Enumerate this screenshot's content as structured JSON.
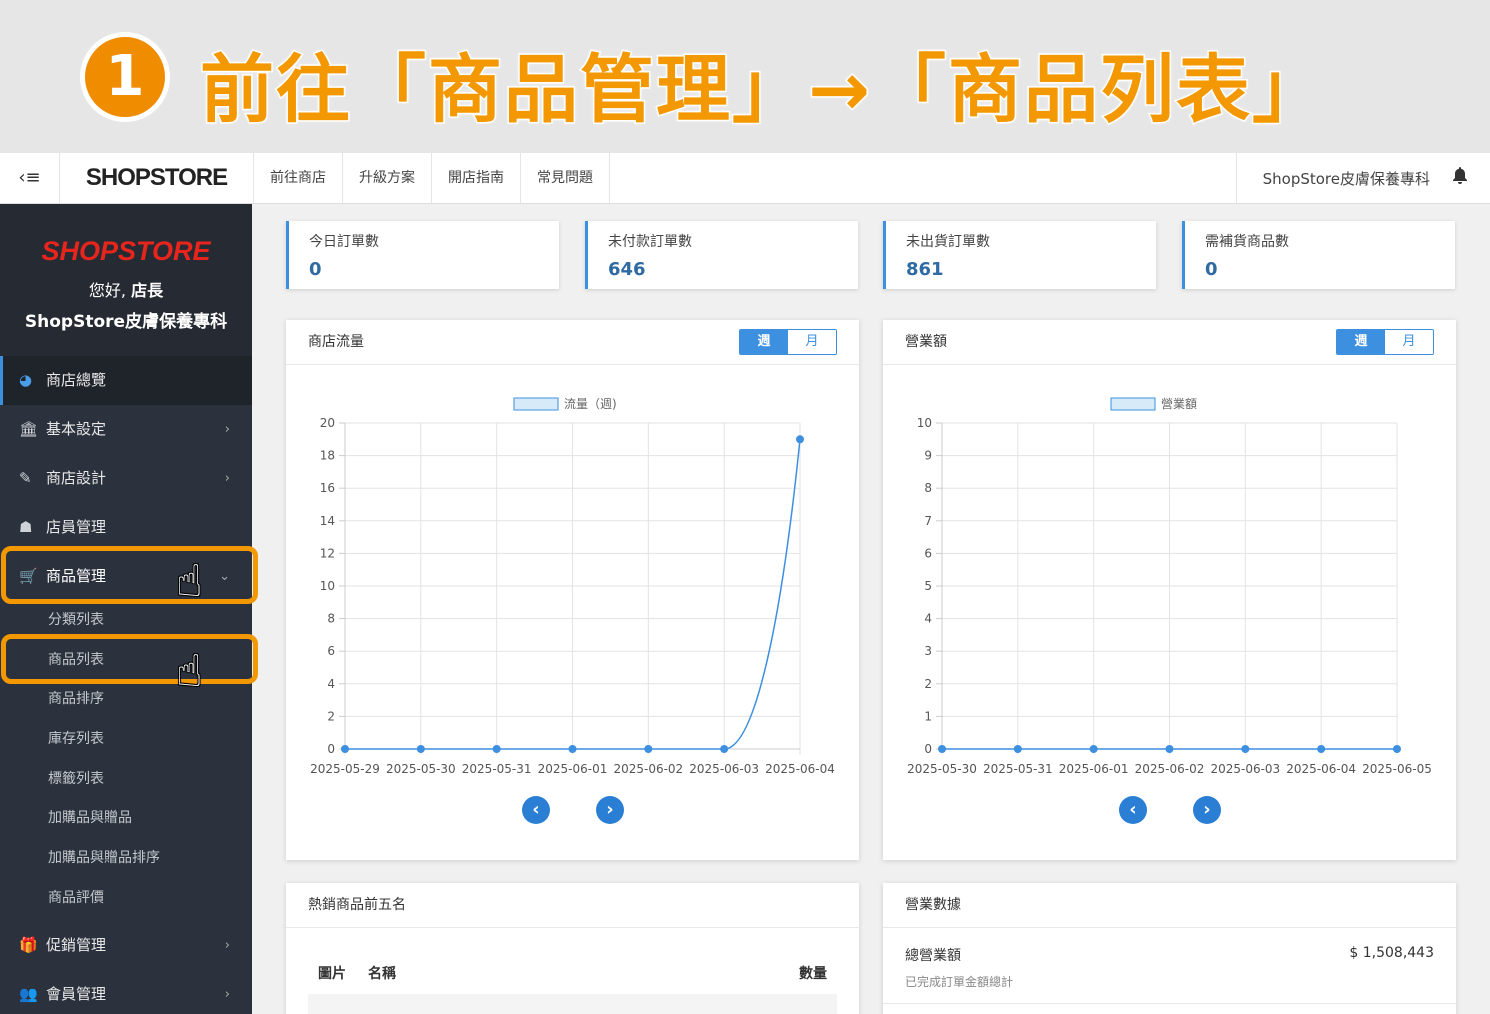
{
  "banner": {
    "step_number": "1",
    "text": "前往「商品管理」→「商品列表」"
  },
  "topbar": {
    "toggle_label": "‹≡",
    "logo": "SHOPSTORE",
    "nav": [
      "前往商店",
      "升級方案",
      "開店指南",
      "常見問題"
    ],
    "store_name": "ShopStore皮膚保養專科"
  },
  "sidebar": {
    "logo": "SHOPSTORE",
    "hello": "您好,",
    "hello_role": "店長",
    "store": "ShopStore皮膚保養專科",
    "items": [
      {
        "label": "商店總覽"
      },
      {
        "label": "基本設定"
      },
      {
        "label": "商店設計"
      },
      {
        "label": "店員管理"
      },
      {
        "label": "商品管理"
      }
    ],
    "subitems": [
      "分類列表",
      "商品列表",
      "商品排序",
      "庫存列表",
      "標籤列表",
      "加購品與贈品",
      "加購品與贈品排序",
      "商品評價"
    ],
    "after_items": [
      {
        "label": "促銷管理"
      },
      {
        "label": "會員管理"
      }
    ]
  },
  "stats": [
    {
      "label": "今日訂單數",
      "value": "0"
    },
    {
      "label": "未付款訂單數",
      "value": "646"
    },
    {
      "label": "未出貨訂單數",
      "value": "861"
    },
    {
      "label": "需補貨商品數",
      "value": "0"
    }
  ],
  "traffic_panel": {
    "title": "商店流量",
    "week": "週",
    "month": "月"
  },
  "revenue_panel": {
    "title": "營業額",
    "week": "週",
    "month": "月"
  },
  "top5_panel": {
    "title": "熱銷商品前五名",
    "col_image": "圖片",
    "col_name": "名稱",
    "col_qty": "數量"
  },
  "sales_panel": {
    "title": "營業數據",
    "total_label": "總營業額",
    "total_sub": "已完成訂單金額總計",
    "total_value": "$ 1,508,443"
  },
  "colors": {
    "accent": "#3d8fe0",
    "banner_orange": "#f39800",
    "sidebar_bg": "#2c323d"
  },
  "chart_data": [
    {
      "type": "line",
      "series": [
        {
          "name": "流量（週)",
          "values": [
            0,
            0,
            0,
            0,
            0,
            0,
            19
          ]
        }
      ],
      "x": [
        "2025-05-29",
        "2025-05-30",
        "2025-05-31",
        "2025-06-01",
        "2025-06-02",
        "2025-06-03",
        "2025-06-04"
      ],
      "ylim": [
        0,
        20
      ],
      "yticks": [
        0,
        2,
        4,
        6,
        8,
        10,
        12,
        14,
        16,
        18,
        20
      ],
      "legend": "top-center",
      "grid": true
    },
    {
      "type": "line",
      "series": [
        {
          "name": "營業額",
          "values": [
            0,
            0,
            0,
            0,
            0,
            0,
            0
          ]
        }
      ],
      "x": [
        "2025-05-30",
        "2025-05-31",
        "2025-06-01",
        "2025-06-02",
        "2025-06-03",
        "2025-06-04",
        "2025-06-05"
      ],
      "ylim": [
        0,
        10
      ],
      "yticks": [
        0,
        1,
        2,
        3,
        4,
        5,
        6,
        7,
        8,
        9,
        10
      ],
      "legend": "top-center",
      "grid": true
    }
  ]
}
